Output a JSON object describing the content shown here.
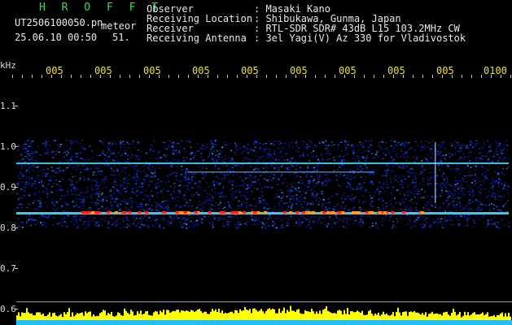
{
  "header": {
    "title": "H R O F F T",
    "filename": "UT2506100050.pn",
    "tag": "meteor",
    "datetime": "25.06.10 00:50",
    "count": "51.",
    "observer_label": "Observer",
    "observer_value": ": Masaki Kano",
    "location_label": "Receiving Location",
    "location_value": ": Shibukawa, Gunma, Japan",
    "receiver_label": "Receiver",
    "receiver_value": ": RTL-SDR SDR# 43dB L15 103.2MHz CW",
    "antenna_label": "Receiving Antenna",
    "antenna_value": ": 3el Yagi(V) Az 330 for Vladivostok"
  },
  "axis": {
    "unit": "kHz",
    "y_ticks": [
      "1.1",
      "1.0",
      "0.9",
      "0.8",
      "0.7",
      "0.6"
    ],
    "x_ticks": [
      "005",
      "005",
      "005",
      "005",
      "005",
      "005",
      "005",
      "005",
      "005",
      "0100"
    ]
  },
  "colors": {
    "background": "#000000",
    "header_green": "#2fe05a",
    "tick_yellow": "#e8e040",
    "noise_blue": "#1030c0",
    "signal_line": "#40e0ff",
    "meteor_red": "#ff2020",
    "power_yellow": "#ffff00",
    "power_cyan": "#20c0ff"
  }
}
